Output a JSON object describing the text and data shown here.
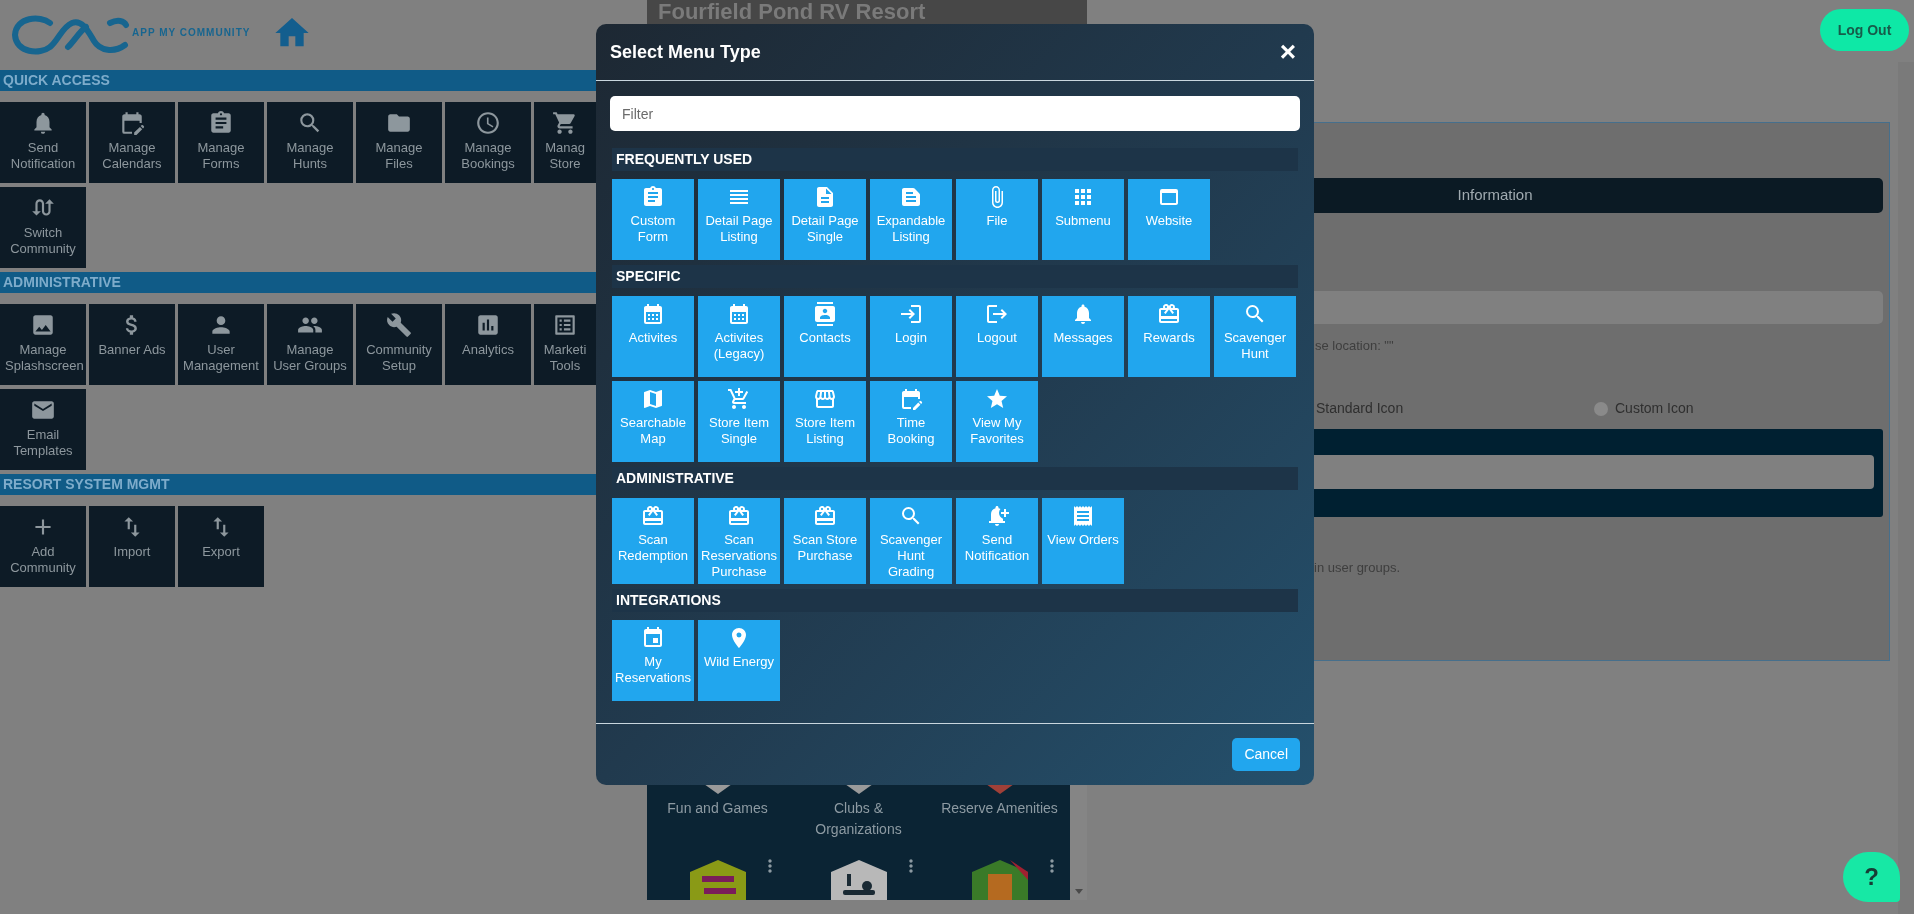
{
  "header": {
    "logo_text": "APP MY COMMUNITY"
  },
  "sections": [
    {
      "title": "QUICK ACCESS",
      "tiles": [
        "Send Notification",
        "Manage Calendars",
        "Manage Forms",
        "Manage Hunts",
        "Manage Files",
        "Manage Bookings",
        "Manag Store",
        "Switch Community"
      ]
    },
    {
      "title": "ADMINISTRATIVE",
      "tiles": [
        "Manage Splashscreen",
        "Banner Ads",
        "User Management",
        "Manage User Groups",
        "Community Setup",
        "Analytics",
        "Marketi Tools",
        "Email Templates"
      ]
    },
    {
      "title": "RESORT SYSTEM MGMT",
      "tiles": [
        "Add Community",
        "Import",
        "Export"
      ]
    }
  ],
  "preview": {
    "title": "Fourfield Pond RV Resort",
    "items": [
      "Fun and Games",
      "Clubs & Organizations",
      "Reserve Amenities"
    ]
  },
  "logout_button": "Log Out",
  "panel": {
    "tab": "Information",
    "location_note": "se location: \"\"",
    "radios": [
      {
        "label": "Standard Icon"
      },
      {
        "label": "Custom Icon",
        "selected": false
      }
    ],
    "groups_note": "in user groups."
  },
  "modal": {
    "title": "Select Menu Type",
    "close": "×",
    "filter_placeholder": "Filter",
    "sections": [
      {
        "title": "FREQUENTLY USED",
        "tiles": [
          "Custom Form",
          "Detail Page Listing",
          "Detail Page Single",
          "Expandable Listing",
          "File",
          "Submenu",
          "Website"
        ]
      },
      {
        "title": "SPECIFIC",
        "tiles": [
          "Activites",
          "Activites (Legacy)",
          "Contacts",
          "Login",
          "Logout",
          "Messages",
          "Rewards",
          "Scavenger Hunt",
          "Searchable Map",
          "Store Item Single",
          "Store Item Listing",
          "Time Booking",
          "View My Favorites"
        ]
      },
      {
        "title": "ADMINISTRATIVE",
        "tiles": [
          "Scan Redemption",
          "Scan Reservations Purchase",
          "Scan Store Purchase",
          "Scavenger Hunt Grading",
          "Send Notification",
          "View Orders"
        ]
      },
      {
        "title": "INTEGRATIONS",
        "tiles": [
          "My Reservations",
          "Wild Energy"
        ]
      }
    ],
    "cancel_button": "Cancel"
  },
  "help_button": "?"
}
